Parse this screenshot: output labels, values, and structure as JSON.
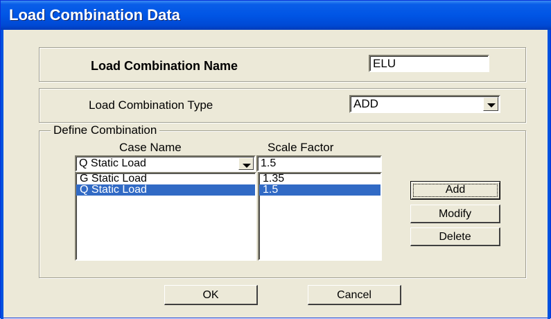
{
  "window": {
    "title": "Load Combination Data"
  },
  "combination_name": {
    "label": "Load Combination Name",
    "value": "ELU"
  },
  "combination_type": {
    "label": "Load Combination Type",
    "value": "ADD"
  },
  "define": {
    "group_label": "Define Combination",
    "case_name_header": "Case Name",
    "scale_factor_header": "Scale Factor",
    "case_select": "Q Static Load",
    "scale_input": "1.5",
    "rows": [
      {
        "case": "G Static Load",
        "factor": "1.35"
      },
      {
        "case": "Q Static Load",
        "factor": "1.5"
      }
    ],
    "selected_row": 1
  },
  "buttons": {
    "add": "Add",
    "modify": "Modify",
    "delete": "Delete",
    "ok": "OK",
    "cancel": "Cancel"
  },
  "colors": {
    "title_bar": "#0055e5",
    "selection": "#316ac5",
    "dialog_bg": "#ece9d8"
  }
}
